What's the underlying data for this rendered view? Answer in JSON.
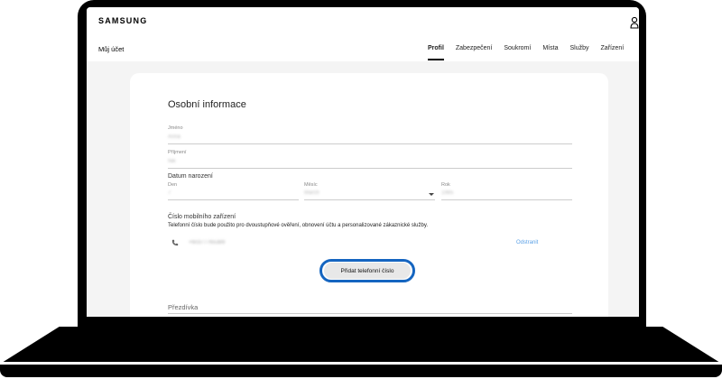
{
  "app": {
    "logo": "SAMSUNG"
  },
  "nav": {
    "account_label": "Můj účet",
    "tabs": [
      {
        "label": "Profil",
        "active": true
      },
      {
        "label": "Zabezpečení",
        "active": false
      },
      {
        "label": "Soukromí",
        "active": false
      },
      {
        "label": "Místa",
        "active": false
      },
      {
        "label": "Služby",
        "active": false
      },
      {
        "label": "Zařízení",
        "active": false
      }
    ]
  },
  "personal_info": {
    "title": "Osobní informace",
    "first_name": {
      "label": "Jméno",
      "value": "Anna"
    },
    "last_name": {
      "label": "Příjmení",
      "value": "Nik"
    },
    "birth_date": {
      "label": "Datum narození",
      "day": {
        "label": "Den",
        "value": "7"
      },
      "month": {
        "label": "Měsíc",
        "value": "March"
      },
      "year": {
        "label": "Rok",
        "value": "1985"
      }
    },
    "phone": {
      "label": "Číslo mobilního zařízení",
      "description": "Telefonní číslo bude použito pro dvoustupňové ověření, obnovení účtu a personalizované zákaznické služby.",
      "number": "+60377765389",
      "remove_label": "Odstranit",
      "add_label": "Přidat telefonní číslo"
    },
    "nickname": {
      "label": "Přezdívka"
    }
  },
  "colors": {
    "highlight": "#1565c0",
    "link": "#5aa0e6",
    "background": "#f4f4f4"
  }
}
